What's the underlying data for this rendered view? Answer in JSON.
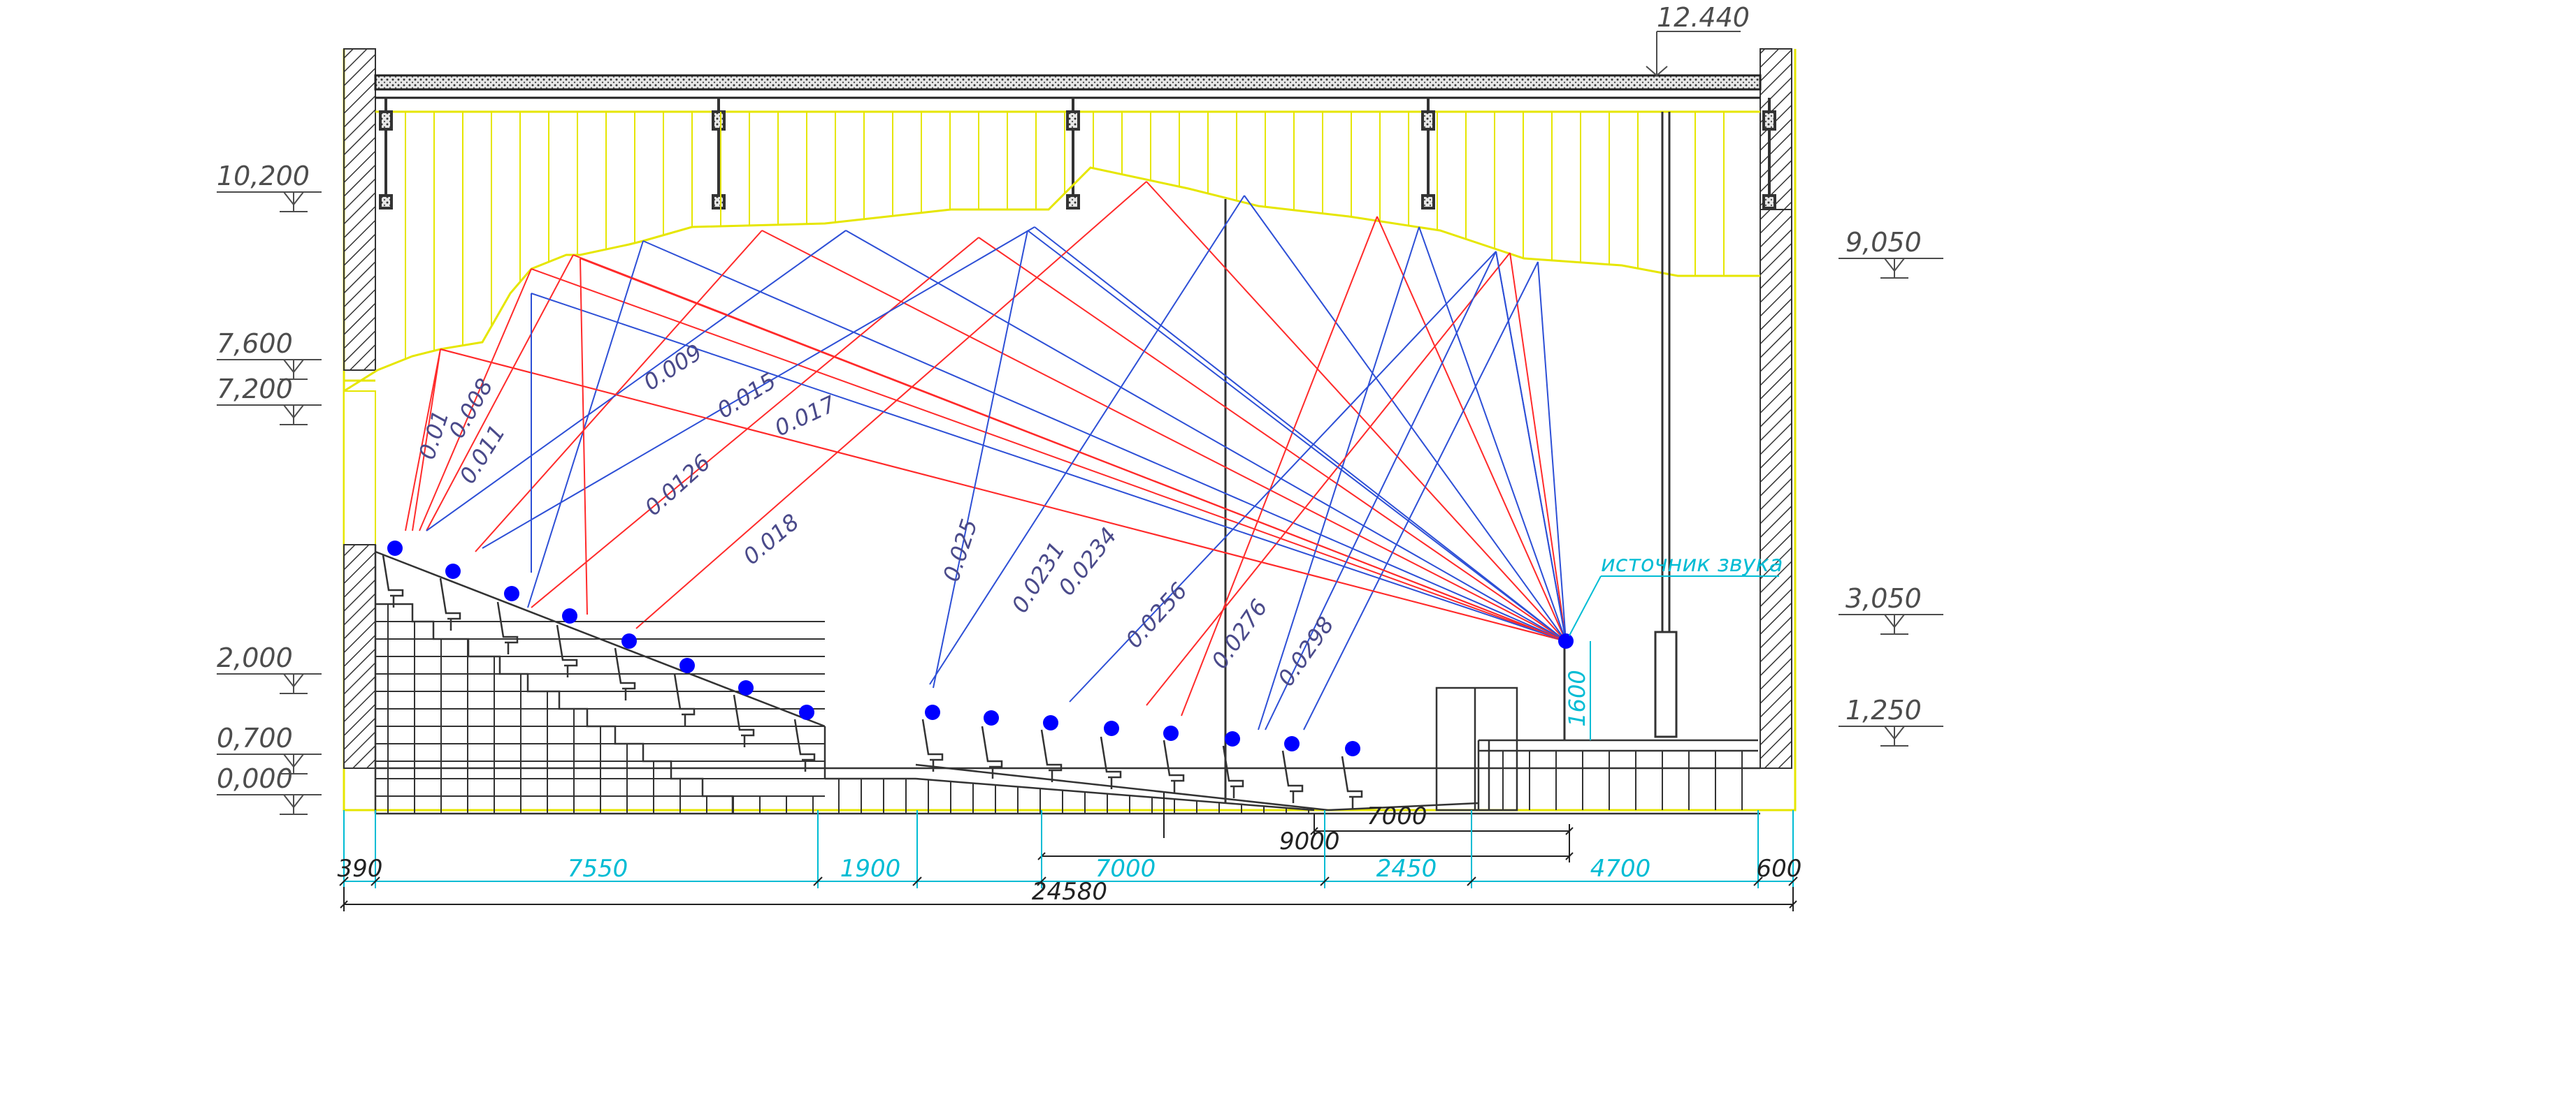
{
  "colors": {
    "reflection_red": "#ff2a2a",
    "reflection_blue": "#2d4fd6",
    "ceiling_yellow": "#e6e600",
    "listener_blue": "#0000ff",
    "dimension_cyan": "#00bcd4",
    "structure": "#222222"
  },
  "elevation_marks": {
    "top": "12.440",
    "left": [
      "10,200",
      "7,600",
      "7,200",
      "2,000",
      "0,700",
      "0,000"
    ],
    "right": [
      "9,050",
      "3,050",
      "1,250"
    ]
  },
  "source_label": "источник звука",
  "source_height": "1600",
  "dimensions": {
    "bottom_segments": [
      "390",
      "7550",
      "1900",
      "7000",
      "2450",
      "4700",
      "600"
    ],
    "total": "24580",
    "stage_top": "7000",
    "stage_mid": "9000"
  },
  "coefficients": [
    "0.01",
    "0.008",
    "0.011",
    "0.009",
    "0.015",
    "0.017",
    "0.0126",
    "0.018",
    "0.025",
    "0.0231",
    "0.0234",
    "0.0256",
    "0.0276",
    "0.0298"
  ]
}
